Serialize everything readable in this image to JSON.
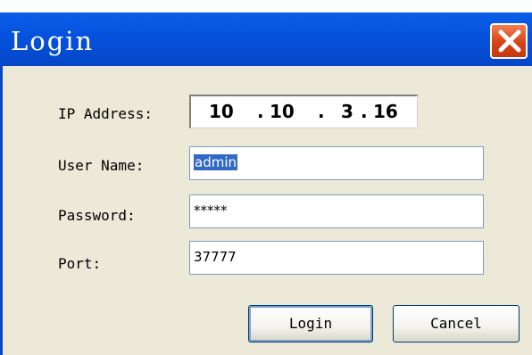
{
  "window": {
    "title": "Login",
    "close_icon": "close-icon"
  },
  "form": {
    "ip_label": "IP Address:",
    "ip": [
      "10",
      "10",
      "3",
      "16"
    ],
    "user_label": "User Name:",
    "user_value": "admin",
    "password_label": "Password:",
    "password_value": "*****",
    "port_label": "Port:",
    "port_value": "37777"
  },
  "buttons": {
    "login": "Login",
    "cancel": "Cancel"
  },
  "colors": {
    "titlebar": "#0651dd",
    "dialog_bg": "#ece9d8",
    "close_button": "#d84318",
    "selection": "#316ac5"
  }
}
